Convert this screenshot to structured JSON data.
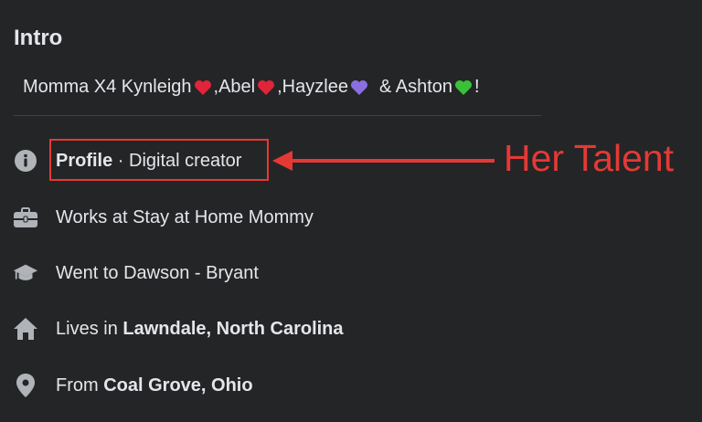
{
  "intro": {
    "title": "Intro",
    "bio": {
      "part1": "Momma X4 Kynleigh",
      "part2": ",Abel",
      "part3": ",Hayzlee",
      "part4": "& Ashton",
      "part5": "!"
    }
  },
  "details": {
    "profile": {
      "bold": "Profile",
      "rest": " · Digital creator",
      "icon": "info-icon"
    },
    "work": {
      "text": "Works at Stay at Home Mommy",
      "icon": "briefcase-icon"
    },
    "education": {
      "text": "Went to Dawson - Bryant",
      "icon": "graduation-cap-icon"
    },
    "lives": {
      "prefix": "Lives in ",
      "place": "Lawndale, North Carolina",
      "icon": "home-icon"
    },
    "from": {
      "prefix": "From ",
      "place": "Coal Grove, Ohio",
      "icon": "location-pin-icon"
    }
  },
  "annotation": {
    "label": "Her Talent",
    "color": "#e53935"
  },
  "colors": {
    "background": "#242526",
    "text": "#e4e6eb",
    "icon": "#b0b3b8",
    "heart_red": "#e0243a",
    "heart_purple": "#8b6fe0",
    "heart_green": "#39c238"
  }
}
